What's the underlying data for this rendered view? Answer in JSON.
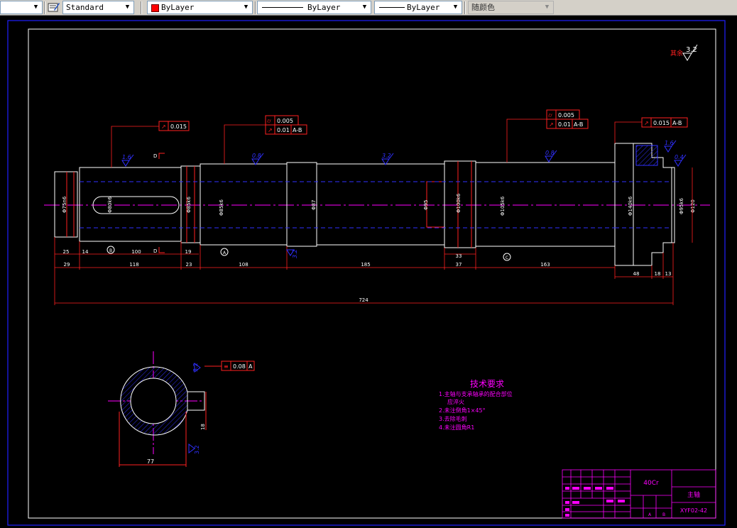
{
  "toolbar": {
    "text_style": "Standard",
    "color": "ByLayer",
    "color_swatch": "#ff0000",
    "linetype": "ByLayer",
    "lineweight": "ByLayer",
    "plot_style": "随颜色"
  },
  "drawing": {
    "top_roughness": {
      "label": "其余",
      "value": "3.2"
    },
    "tolerances": {
      "runout_1": "0.015",
      "cyl_1": "0.005",
      "runout_2": "0.01",
      "ref_AB_1": "A-B",
      "cyl_2": "0.005",
      "runout_3": "0.01",
      "ref_AB_2": "A-B",
      "runout_4": "0.015",
      "ref_AB_3": "A-B",
      "sym": "0.08",
      "ref_A": "A"
    },
    "section_marks": {
      "d1": "D",
      "d2": "D"
    },
    "datums": {
      "b": "B",
      "a": "A",
      "c": "C"
    },
    "roughness": {
      "r1": "1.6",
      "r2": "0.8",
      "r3": "3.2",
      "r4": "0.8",
      "r5": "1.6",
      "r6": "0.4",
      "r7": "3.2",
      "r8": "3.2",
      "r9": "3.2"
    },
    "dims": {
      "d25": "25",
      "d14": "14",
      "d100": "100",
      "d19": "19",
      "d33": "33",
      "d29": "29",
      "d118": "118",
      "d23": "23",
      "d108": "108",
      "d185": "185",
      "d37": "37",
      "d163": "163",
      "d48": "48",
      "d18": "18",
      "d13": "13",
      "d724": "724",
      "d77": "77",
      "d18b": "18",
      "dia1": "Φ75n6",
      "dia2": "Φ80k6",
      "dia3": "Φ85k6",
      "dia4": "Φ85k6",
      "dia5": "Φ87",
      "dia6": "Φ95",
      "dia7": "Φ100k6",
      "dia8": "Φ105k6",
      "dia9": "Φ140k6",
      "dia10": "Φ95k6",
      "dia11": "Φ120"
    },
    "tech_req": {
      "title": "技术要求",
      "lines": [
        "1.主轴与支承轴承的配合部位",
        "应淬火",
        "2.未注倒角1×45°",
        "3.去除毛刺",
        "4.未注圆角R1"
      ]
    },
    "title_block": {
      "material": "40Cr",
      "name": "主轴",
      "code": "XYF02-42",
      "cell_a": "A",
      "cell_b": "B"
    }
  }
}
